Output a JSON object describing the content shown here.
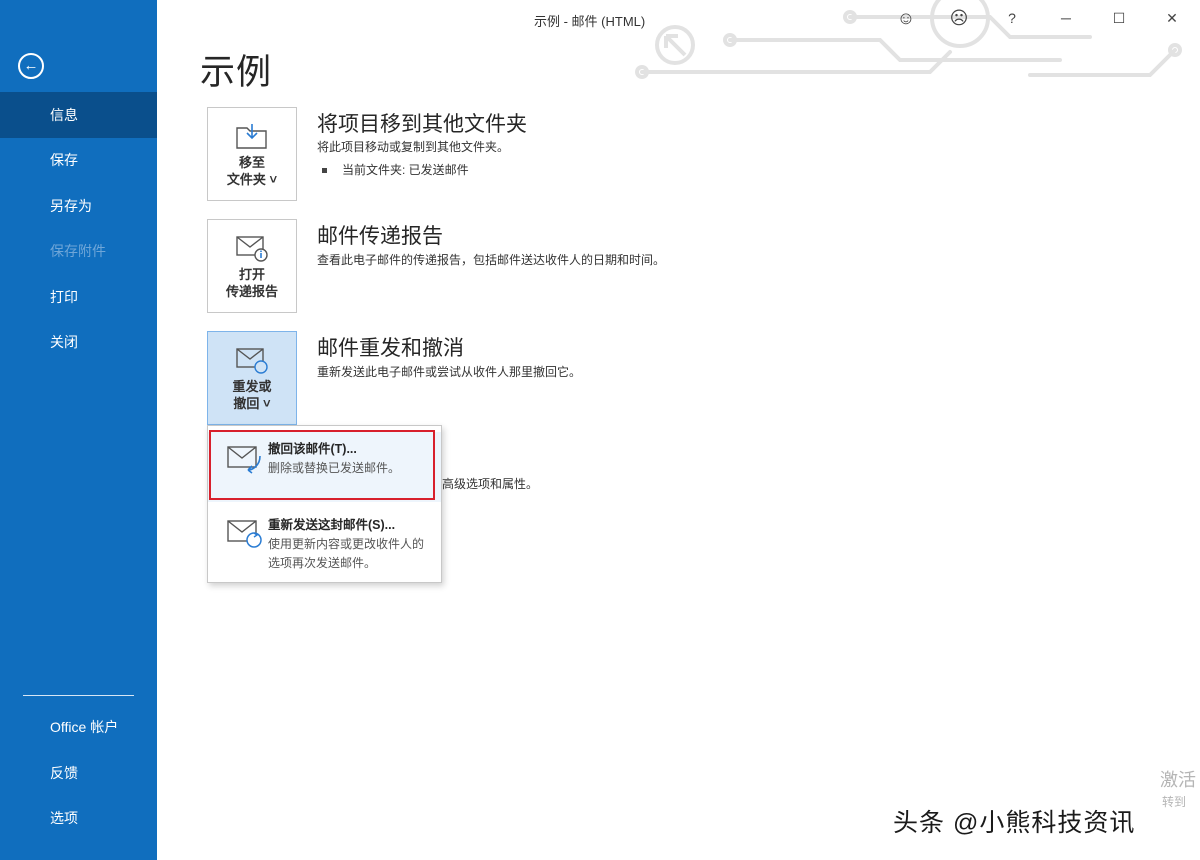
{
  "window": {
    "title": "示例 - 邮件 (HTML)"
  },
  "titlebar": {
    "smile": "☺",
    "frown": "☹",
    "help": "?",
    "minimize": "─",
    "maximize": "☐",
    "close": "✕"
  },
  "sidebar": {
    "items": [
      {
        "label": "信息",
        "state": "active"
      },
      {
        "label": "保存"
      },
      {
        "label": "另存为"
      },
      {
        "label": "保存附件",
        "state": "disabled"
      },
      {
        "label": "打印"
      },
      {
        "label": "关闭"
      }
    ],
    "bottom": [
      {
        "label": "Office 帐户"
      },
      {
        "label": "反馈"
      },
      {
        "label": "选项"
      }
    ]
  },
  "page_title": "示例",
  "sections": {
    "move": {
      "tile_label": "移至\n文件夹 ˅",
      "title": "将项目移到其他文件夹",
      "desc": "将此项目移动或复制到其他文件夹。",
      "bullet": "当前文件夹:   已发送邮件"
    },
    "report": {
      "tile_label": "打开\n传递报告",
      "title": "邮件传递报告",
      "desc": "查看此电子邮件的传递报告，包括邮件送达收件人的日期和时间。"
    },
    "resend": {
      "tile_label": "重发或\n撤回 ˅",
      "title": "邮件重发和撤消",
      "desc": "重新发送此电子邮件或尝试从收件人那里撤回它。"
    }
  },
  "partial_text": "高级选项和属性。",
  "dropdown": {
    "recall": {
      "title": "撤回该邮件(T)...",
      "desc": "删除或替换已发送邮件。"
    },
    "resend": {
      "title": "重新发送这封邮件(S)...",
      "desc": "使用更新内容或更改收件人的选项再次发送邮件。"
    }
  },
  "overlay": {
    "watermark": "头条 @小熊科技资讯",
    "activate_line1": "激活",
    "activate_line2": "转到"
  },
  "colors": {
    "sidebar": "#106ebe",
    "sidebar_active": "#0a4f8c",
    "highlight_border": "#d8202c",
    "tile_active": "#cfe3f6"
  }
}
